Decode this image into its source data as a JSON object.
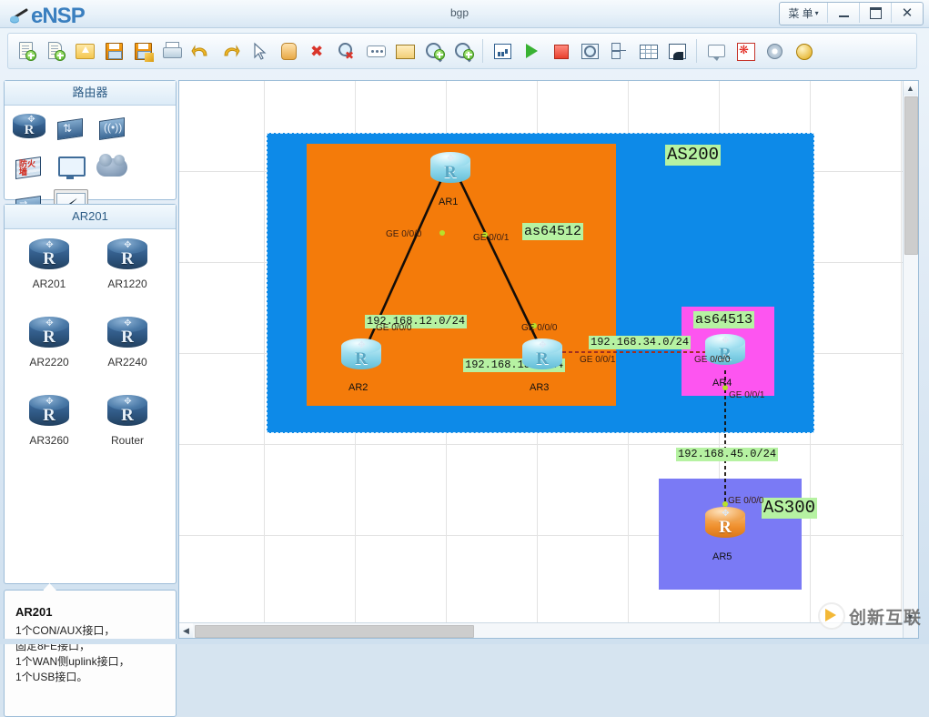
{
  "window": {
    "app_name": "eNSP",
    "title": "bgp",
    "menu_label": "菜 单",
    "minimize_label": "Minimize",
    "maximize_label": "Maximize",
    "close_label": "Close"
  },
  "toolbar": {
    "buttons": [
      {
        "name": "new-topology-icon",
        "tip": "New Topology"
      },
      {
        "name": "new-page-icon",
        "tip": "New Page"
      },
      {
        "name": "open-folder-icon",
        "tip": "Open"
      },
      {
        "name": "save-icon",
        "tip": "Save"
      },
      {
        "name": "save-as-icon",
        "tip": "Save As"
      },
      {
        "name": "print-icon",
        "tip": "Print"
      },
      {
        "name": "undo-icon",
        "tip": "Undo"
      },
      {
        "name": "redo-icon",
        "tip": "Redo"
      },
      {
        "name": "select-pointer-icon",
        "tip": "Select"
      },
      {
        "name": "pan-hand-icon",
        "tip": "Pan"
      },
      {
        "name": "delete-icon",
        "tip": "Delete"
      },
      {
        "name": "delete-link-icon",
        "tip": "Delete Link"
      },
      {
        "name": "add-note-icon",
        "tip": "Add Note"
      },
      {
        "name": "add-shape-icon",
        "tip": "Add Shape"
      },
      {
        "name": "zoom-in-icon",
        "tip": "Zoom In"
      },
      {
        "name": "zoom-out-icon",
        "tip": "Zoom Out"
      },
      {
        "name": "statistics-icon",
        "tip": "Statistics"
      },
      {
        "name": "start-device-icon",
        "tip": "Start Device"
      },
      {
        "name": "stop-device-icon",
        "tip": "Stop Device"
      },
      {
        "name": "capture-packet-icon",
        "tip": "Capture Packet"
      },
      {
        "name": "device-manage-icon",
        "tip": "Device Manager"
      },
      {
        "name": "grid-icon",
        "tip": "Grid"
      },
      {
        "name": "screenshot-icon",
        "tip": "Screenshot"
      },
      {
        "name": "comment-icon",
        "tip": "Comment"
      },
      {
        "name": "huawei-icon",
        "tip": "Huawei"
      },
      {
        "name": "settings-gear-icon",
        "tip": "Settings"
      },
      {
        "name": "help-icon",
        "tip": "Help"
      }
    ]
  },
  "sidebar": {
    "device_panel": {
      "title": "路由器",
      "items": [
        {
          "name": "router-category-icon",
          "label": "Router",
          "selected": false
        },
        {
          "name": "switch-category-icon",
          "label": "Switch",
          "selected": false
        },
        {
          "name": "wlan-category-icon",
          "label": "WLAN",
          "selected": false
        },
        {
          "name": "firewall-category-icon",
          "label": "Firewall",
          "selected": false
        },
        {
          "name": "endpoint-category-icon",
          "label": "Endpoint",
          "selected": false
        },
        {
          "name": "cloud-category-icon",
          "label": "Cloud",
          "selected": false
        },
        {
          "name": "lan-switch-category-icon",
          "label": "LAN Switch",
          "selected": false
        },
        {
          "name": "connection-category-icon",
          "label": "Connections",
          "selected": true
        }
      ]
    },
    "model_panel": {
      "title": "AR201",
      "models": [
        {
          "label": "AR201"
        },
        {
          "label": "AR1220"
        },
        {
          "label": "AR2220"
        },
        {
          "label": "AR2240"
        },
        {
          "label": "AR3260"
        },
        {
          "label": "Router"
        }
      ]
    },
    "info_panel": {
      "title": "AR201",
      "lines": [
        "1个CON/AUX接口，",
        "固定8FE接口，",
        "1个WAN侧uplink接口，",
        "1个USB接口。"
      ]
    }
  },
  "canvas": {
    "as_boxes": [
      {
        "id": "as200",
        "label": "AS200",
        "color": "#0d8ae8",
        "label_style": "big"
      },
      {
        "id": "as64512",
        "label": "as64512",
        "color": "#f47b0a",
        "label_style": "mid"
      },
      {
        "id": "as64513",
        "label": "as64513",
        "color": "#fd55f0",
        "label_style": "mid"
      },
      {
        "id": "as300",
        "label": "AS300",
        "color": "#7a7af5",
        "label_style": "big"
      }
    ],
    "nodes": [
      {
        "id": "AR1",
        "label": "AR1",
        "color": "cyan"
      },
      {
        "id": "AR2",
        "label": "AR2",
        "color": "cyan"
      },
      {
        "id": "AR3",
        "label": "AR3",
        "color": "cyan"
      },
      {
        "id": "AR4",
        "label": "AR4",
        "color": "cyan"
      },
      {
        "id": "AR5",
        "label": "AR5",
        "color": "orange"
      }
    ],
    "networks": [
      {
        "label": "192.168.12.0/24"
      },
      {
        "label": "192.168.13.0/24"
      },
      {
        "label": "192.168.34.0/24"
      },
      {
        "label": "192.168.45.0/24"
      }
    ],
    "interfaces": [
      {
        "label": "GE 0/0/0",
        "node": "AR1",
        "side": "left"
      },
      {
        "label": "GE 0/0/1",
        "node": "AR1",
        "side": "right"
      },
      {
        "label": "GE 0/0/0",
        "node": "AR2"
      },
      {
        "label": "GE 0/0/0",
        "node": "AR3"
      },
      {
        "label": "GE 0/0/1",
        "node": "AR3"
      },
      {
        "label": "GE 0/0/0",
        "node": "AR4"
      },
      {
        "label": "GE 0/0/1",
        "node": "AR4"
      },
      {
        "label": "GE 0/0/0",
        "node": "AR5"
      }
    ],
    "colors": {
      "as200": "#0d8ae8",
      "as64512": "#f47b0a",
      "as64513": "#fd55f0",
      "as300": "#7a7af5",
      "tag_bg": "#b6f2a2",
      "link": "#140d08"
    }
  },
  "watermark": {
    "text": "创新互联"
  }
}
